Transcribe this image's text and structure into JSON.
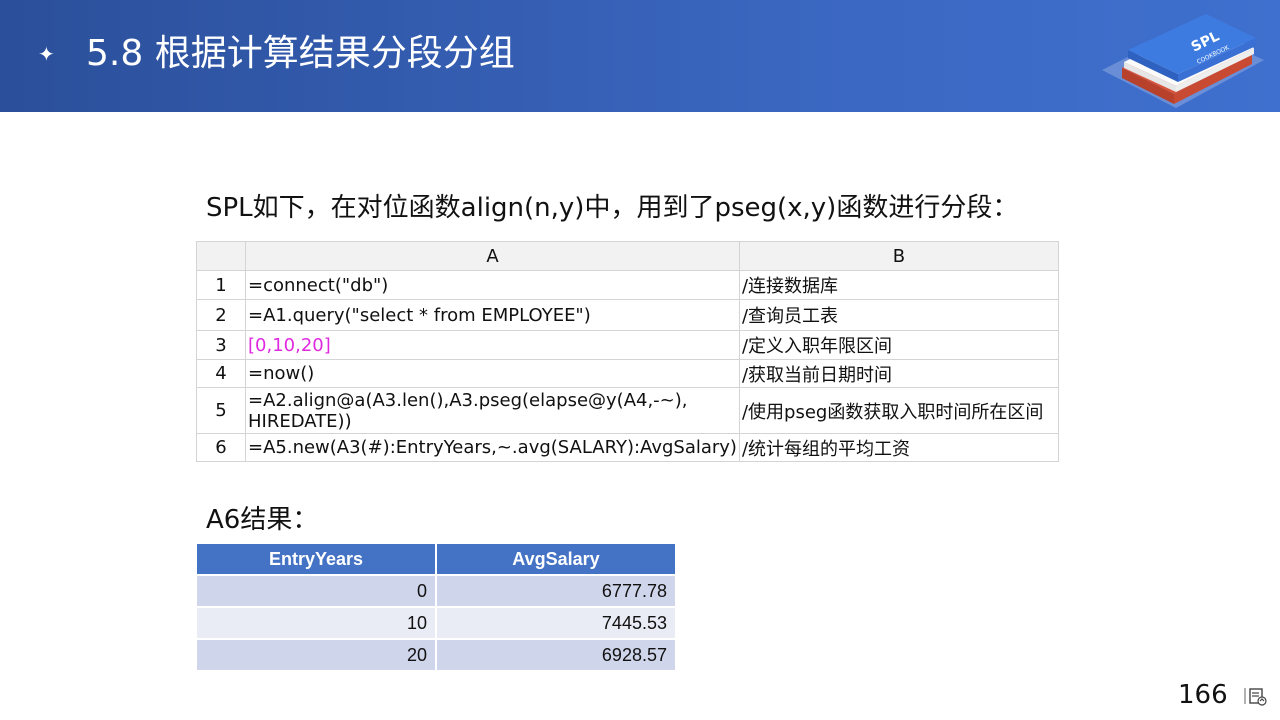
{
  "header": {
    "spark": "✦",
    "title": "5.8  根据计算结果分段分组",
    "logo_text": "SPL",
    "logo_subtext": "COOKBOOK"
  },
  "intro": "SPL如下，在对位函数align(n,y)中，用到了pseg(x,y)函数进行分段：",
  "spl_grid": {
    "col_headers": [
      "A",
      "B"
    ],
    "rows": [
      {
        "num": "1",
        "a": "=connect(\"db\")",
        "b": "/连接数据库"
      },
      {
        "num": "2",
        "a": "=A1.query(\"select * from EMPLOYEE\")",
        "b": "/查询员工表"
      },
      {
        "num": "3",
        "a": "[0,10,20]",
        "b": "/定义入职年限区间"
      },
      {
        "num": "4",
        "a": "=now()",
        "b": "/获取当前日期时间"
      },
      {
        "num": "5",
        "a": "=A2.align@a(A3.len(),A3.pseg(elapse@y(A4,-~), HIREDATE))",
        "b": "/使用pseg函数获取入职时间所在区间"
      },
      {
        "num": "6",
        "a": "=A5.new(A3(#):EntryYears,~.avg(SALARY):AvgSalary)",
        "b": "/统计每组的平均工资"
      }
    ],
    "highlight_color": "#e02ae0"
  },
  "result": {
    "title": "A6结果：",
    "headers": [
      "EntryYears",
      "AvgSalary"
    ],
    "rows": [
      {
        "entry": "0",
        "avg": "6777.78"
      },
      {
        "entry": "10",
        "avg": "7445.53"
      },
      {
        "entry": "20",
        "avg": "6928.57"
      }
    ],
    "header_color": "#4472c4"
  },
  "page_number": "166",
  "nav_icon": "slide-nav-icon"
}
